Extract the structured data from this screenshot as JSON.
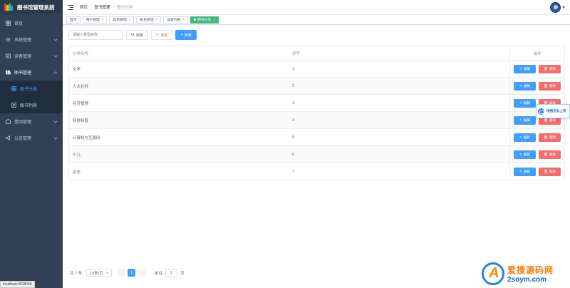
{
  "app": {
    "title": "图书馆管理系统"
  },
  "sidebar": {
    "items": [
      {
        "label": "首页",
        "icon": "dashboard-icon"
      },
      {
        "label": "系统管理",
        "icon": "gear-icon"
      },
      {
        "label": "读者管理",
        "icon": "reader-card-icon"
      },
      {
        "label": "图书管理",
        "icon": "books-icon"
      },
      {
        "label": "借阅管理",
        "icon": "borrow-icon"
      },
      {
        "label": "公告管理",
        "icon": "announcement-icon"
      }
    ],
    "submenu": [
      {
        "label": "图书分类",
        "icon": "category-icon",
        "active": true
      },
      {
        "label": "图书列表",
        "icon": "list-icon",
        "active": false
      }
    ]
  },
  "navbar": {
    "breadcrumb": [
      "首页",
      "图书管理",
      "图书分类"
    ]
  },
  "tags": [
    {
      "label": "首页"
    },
    {
      "label": "用户管理"
    },
    {
      "label": "菜单管理"
    },
    {
      "label": "角色管理"
    },
    {
      "label": "读者列表"
    },
    {
      "label": "图书分类",
      "active": true
    }
  ],
  "toolbar": {
    "search_placeholder": "请输入类型名称",
    "search_label": "搜索",
    "reset_label": "重置",
    "add_label": "新增"
  },
  "table": {
    "headers": [
      "分类名称",
      "序号",
      "操作"
    ],
    "edit_label": "编辑",
    "delete_label": "删除",
    "rows": [
      {
        "name": "文学",
        "order": "1"
      },
      {
        "name": "人文社科",
        "order": "2"
      },
      {
        "name": "经济管理",
        "order": "3"
      },
      {
        "name": "科技科普",
        "order": "4"
      },
      {
        "name": "计算机与互联网",
        "order": "5"
      },
      {
        "name": "少儿",
        "order": "6"
      },
      {
        "name": "杂志",
        "order": "7"
      }
    ]
  },
  "floating_widget": {
    "text": "拖拽至此上传"
  },
  "pagination": {
    "total": "共 7 条",
    "page_size": "10条/页",
    "current_page": "1",
    "goto_prefix": "前往",
    "goto_value": "1",
    "goto_suffix": "页"
  },
  "statusbar": {
    "url": "localhost:9528/#/d"
  },
  "watermark": {
    "line1": "爱搜源码网",
    "line2": "2soym.com"
  },
  "colors": {
    "sidebar": "#304156",
    "primary": "#409eff",
    "danger": "#f56c6c",
    "tag_active": "#42b983"
  }
}
